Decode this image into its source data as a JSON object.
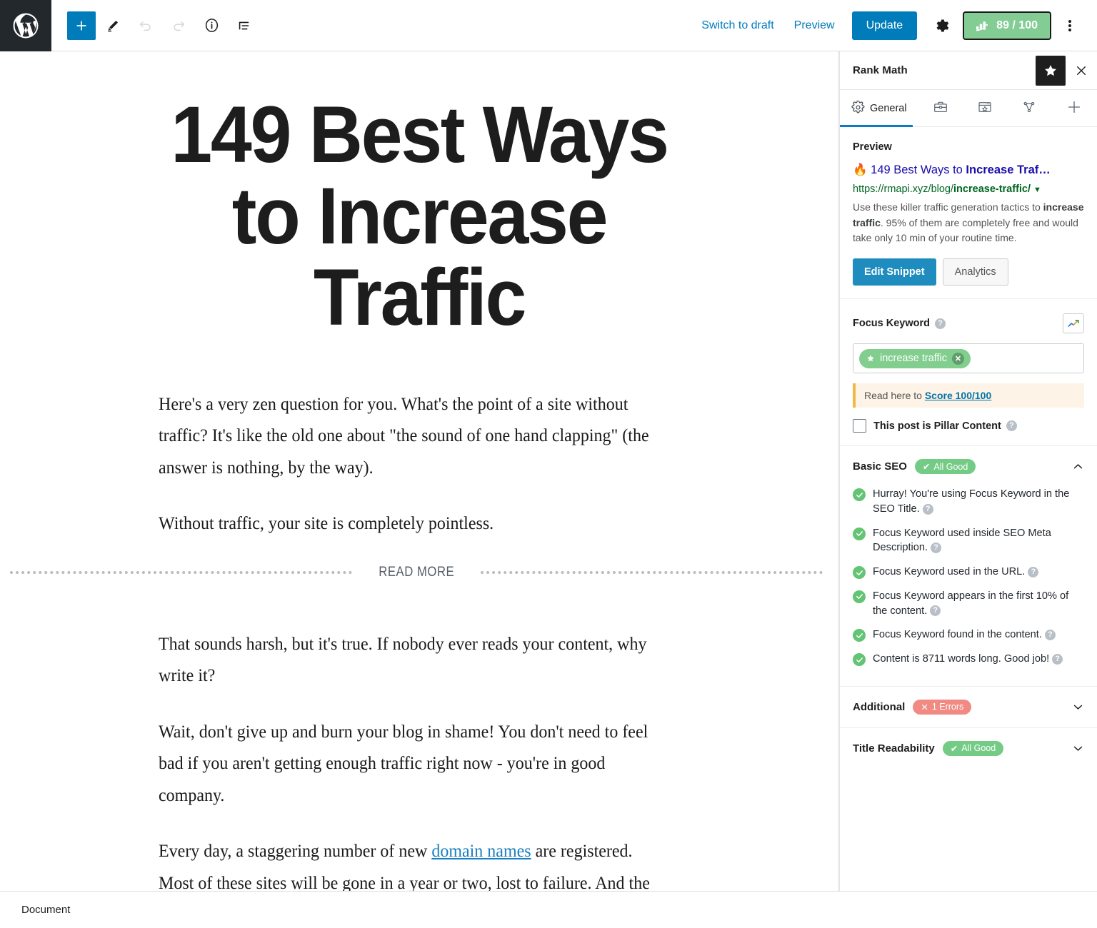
{
  "topbar": {
    "logo_icon": "wordpress-logo-icon",
    "add_block_label": "+",
    "tools": [
      {
        "name": "add-block-button",
        "icon": "plus-icon"
      },
      {
        "name": "edit-tool-button",
        "icon": "pencil-icon"
      },
      {
        "name": "undo-button",
        "icon": "undo-arrow-icon"
      },
      {
        "name": "redo-button",
        "icon": "redo-arrow-icon"
      },
      {
        "name": "details-button",
        "icon": "info-circle-icon"
      },
      {
        "name": "list-view-button",
        "icon": "list-view-icon"
      }
    ],
    "switch_to_draft": "Switch to draft",
    "preview": "Preview",
    "update": "Update",
    "settings_icon": "gear-icon",
    "seo_score": "89 / 100",
    "seo_score_icon": "rank-math-bars-icon",
    "more_icon": "kebab-menu-icon",
    "accent_blue": "#007cba",
    "score_green": "#83cd95"
  },
  "editor": {
    "title": "149 Best Ways to Increase Traffic",
    "paragraphs_before": [
      "Here's a very zen question for you. What's the point of a site without traffic? It's like the old one about \"the sound of one hand clapping\" (the answer is nothing, by the way).",
      "Without traffic, your site is completely pointless."
    ],
    "read_more_label": "READ MORE",
    "paragraphs_after": [
      "That sounds harsh, but it's true. If nobody ever reads your content, why write it?",
      "Wait, don't give up and burn your blog in shame! You don't need to feel bad if you aren't getting enough traffic right now - you're in good company."
    ],
    "last_paragraph": {
      "before_link": "Every day, a staggering number of new ",
      "link_text": "domain names",
      "after_link": " are registered. Most of these sites will be gone in a year or two, lost to failure. And the biggest reason for failure is a lack of traffic."
    }
  },
  "sidebar": {
    "title": "Rank Math",
    "star_icon": "star-icon",
    "close_icon": "close-x-icon",
    "tabs": [
      {
        "label": "General",
        "icon": "gear-icon",
        "active": true
      },
      {
        "label": "",
        "icon": "briefcase-icon",
        "active": false
      },
      {
        "label": "",
        "icon": "browser-star-icon",
        "active": false
      },
      {
        "label": "",
        "icon": "share-nodes-icon",
        "active": false
      },
      {
        "label": "",
        "icon": "plus-icon",
        "active": false
      }
    ],
    "preview": {
      "heading": "Preview",
      "fire_icon": "fire-emoji-icon",
      "title_plain": "149 Best Ways to ",
      "title_keyword": "Increase Traf…",
      "url_base": "https://rmapi.xyz/blog/",
      "url_slug": "increase-traffic/",
      "url_caret": "▼",
      "desc_part1": "Use these killer traffic generation tactics to ",
      "desc_keyword": "increase traffic",
      "desc_part2": ". 95% of them are completely free and would take only 10 min of your routine time.",
      "edit_snippet": "Edit Snippet",
      "analytics": "Analytics"
    },
    "focus_keyword": {
      "label": "Focus Keyword",
      "help_icon": "help-circle-icon",
      "trend_icon": "trending-chart-icon",
      "chip_text": "increase traffic",
      "chip_star_icon": "star-icon",
      "chip_remove_icon": "remove-x-icon",
      "chip_color": "#81ce8e"
    },
    "notice": {
      "prefix": "Read here to ",
      "link": "Score 100/100"
    },
    "pillar": {
      "label": "This post is Pillar Content",
      "checked": false,
      "help_icon": "help-circle-icon"
    },
    "basic_seo": {
      "title": "Basic SEO",
      "badge": "All Good",
      "badge_icon": "check-icon",
      "expanded": true,
      "chevron": "chevron-up-icon",
      "items": [
        "Hurray! You're using Focus Keyword in the SEO Title.",
        "Focus Keyword used inside SEO Meta Description.",
        "Focus Keyword used in the URL.",
        "Focus Keyword appears in the first 10% of the content.",
        "Focus Keyword found in the content.",
        "Content is 8711 words long. Good job!"
      ]
    },
    "additional": {
      "title": "Additional",
      "badge": "1 Errors",
      "badge_icon": "cross-icon",
      "chevron": "chevron-down-icon"
    },
    "title_readability": {
      "title": "Title Readability",
      "badge": "All Good",
      "badge_icon": "check-icon",
      "chevron": "chevron-down-icon"
    }
  },
  "bottombar": {
    "breadcrumb": "Document"
  }
}
